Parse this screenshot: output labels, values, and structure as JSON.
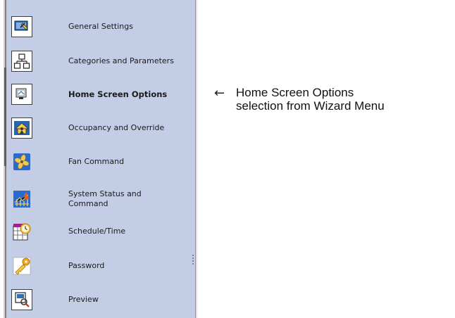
{
  "menu": {
    "items": [
      {
        "label": "General Settings",
        "icon": "general-settings-icon",
        "active": false
      },
      {
        "label": "Categories and Parameters",
        "icon": "categories-icon",
        "active": false
      },
      {
        "label": "Home Screen Options",
        "icon": "home-screen-icon",
        "active": true
      },
      {
        "label": "Occupancy and Override",
        "icon": "occupancy-icon",
        "active": false
      },
      {
        "label": "Fan Command",
        "icon": "fan-icon",
        "active": false
      },
      {
        "label": "System Status and Command",
        "icon": "system-status-icon",
        "active": false
      },
      {
        "label": "Schedule/Time",
        "icon": "schedule-icon",
        "active": false
      },
      {
        "label": "Password",
        "icon": "password-icon",
        "active": false
      },
      {
        "label": "Preview",
        "icon": "preview-icon",
        "active": false
      }
    ]
  },
  "annotation": {
    "arrow": "←",
    "line1": "Home Screen Options",
    "line2": "selection from Wizard Menu"
  },
  "colors": {
    "panel": "#c3cde6",
    "icon_blue": "#2e6fb8",
    "icon_yellow": "#f2c94c"
  }
}
